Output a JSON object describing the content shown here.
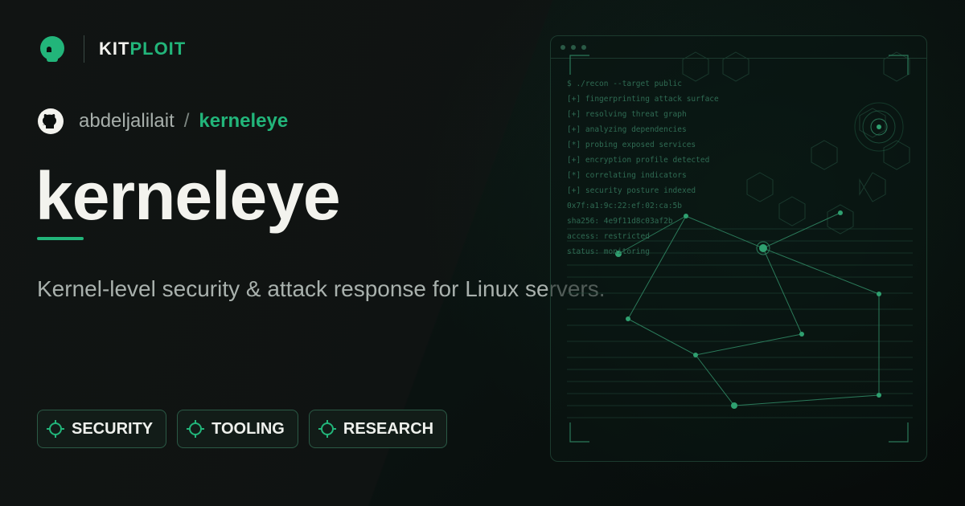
{
  "brand": {
    "name_part1": "KIT",
    "name_part2": "PLOIT",
    "accent_color": "#22b57a"
  },
  "repo": {
    "owner": "abdeljalilait",
    "separator": "/",
    "name": "kerneleye"
  },
  "title": "kerneleye",
  "description": "Kernel-level security & attack response for Linux servers.",
  "tags": [
    {
      "label": "SECURITY",
      "icon": "crosshair-icon"
    },
    {
      "label": "TOOLING",
      "icon": "crosshair-icon"
    },
    {
      "label": "RESEARCH",
      "icon": "crosshair-icon"
    }
  ],
  "terminal": {
    "lines": [
      "$ ./recon --target public",
      "[+] fingerprinting attack surface",
      "[+] resolving threat graph",
      "[+] analyzing dependencies",
      "[*] probing exposed services",
      "[+] encryption profile detected",
      "[*] correlating indicators",
      "[+] security posture indexed",
      "0x7f:a1:9c:22:ef:02:ca:5b",
      "sha256: 4e9f11d8c03af2b",
      "access: restricted",
      "status: monitoring"
    ]
  }
}
